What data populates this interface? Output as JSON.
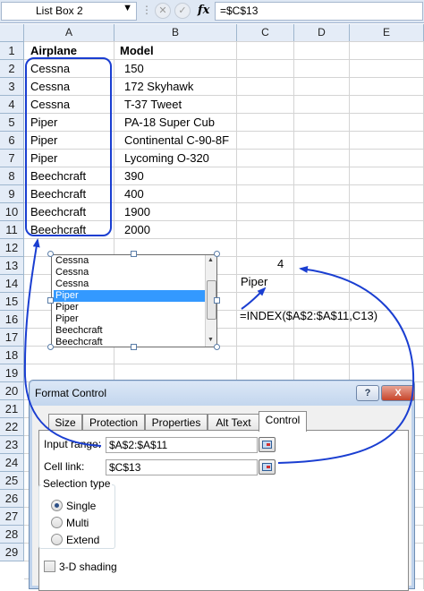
{
  "formula_bar": {
    "name_box": "List Box 2",
    "fx_label": "fx",
    "formula": "=$C$13"
  },
  "columns": [
    "A",
    "B",
    "C",
    "D",
    "E"
  ],
  "rows": [
    "1",
    "2",
    "3",
    "4",
    "5",
    "6",
    "7",
    "8",
    "9",
    "10",
    "11",
    "12",
    "13",
    "14",
    "15",
    "16",
    "17",
    "18",
    "19",
    "20",
    "21",
    "22",
    "23",
    "24",
    "25",
    "26",
    "27",
    "28",
    "29"
  ],
  "table": {
    "header_airplane": "Airplane",
    "header_model": "Model",
    "airplanes": [
      "Cessna",
      "Cessna",
      "Cessna",
      "Piper",
      "Piper",
      "Piper",
      "Beechcraft",
      "Beechcraft",
      "Beechcraft",
      "Beechcraft"
    ],
    "models": [
      "150",
      "172 Skyhawk",
      "T-37 Tweet",
      "PA-18 Super Cub",
      "Continental C-90-8F",
      "Lycoming O-320",
      "390",
      "400",
      "1900",
      "2000"
    ]
  },
  "cells": {
    "c13": "4",
    "c14": "Piper",
    "c16": "=INDEX($A$2:$A$11,C13)"
  },
  "listbox": {
    "items": [
      "Cessna",
      "Cessna",
      "Cessna",
      "Piper",
      "Piper",
      "Piper",
      "Beechcraft",
      "Beechcraft"
    ],
    "selected_index": 3
  },
  "dialog": {
    "title": "Format Control",
    "help": "?",
    "close": "X",
    "tabs": [
      "Size",
      "Protection",
      "Properties",
      "Alt Text",
      "Control"
    ],
    "active_tab": "Control",
    "input_range_label": "Input range:",
    "input_range_value": "$A$2:$A$11",
    "cell_link_label": "Cell link:",
    "cell_link_value": "$C$13",
    "selection_type_label": "Selection type",
    "selection_options": [
      "Single",
      "Multi",
      "Extend"
    ],
    "selected_option": "Single",
    "shading_label": "3-D shading"
  },
  "colors": {
    "annotation_blue": "#1a3ed1",
    "selection_blue": "#3399ff",
    "header_bg": "#e4ecf7"
  }
}
